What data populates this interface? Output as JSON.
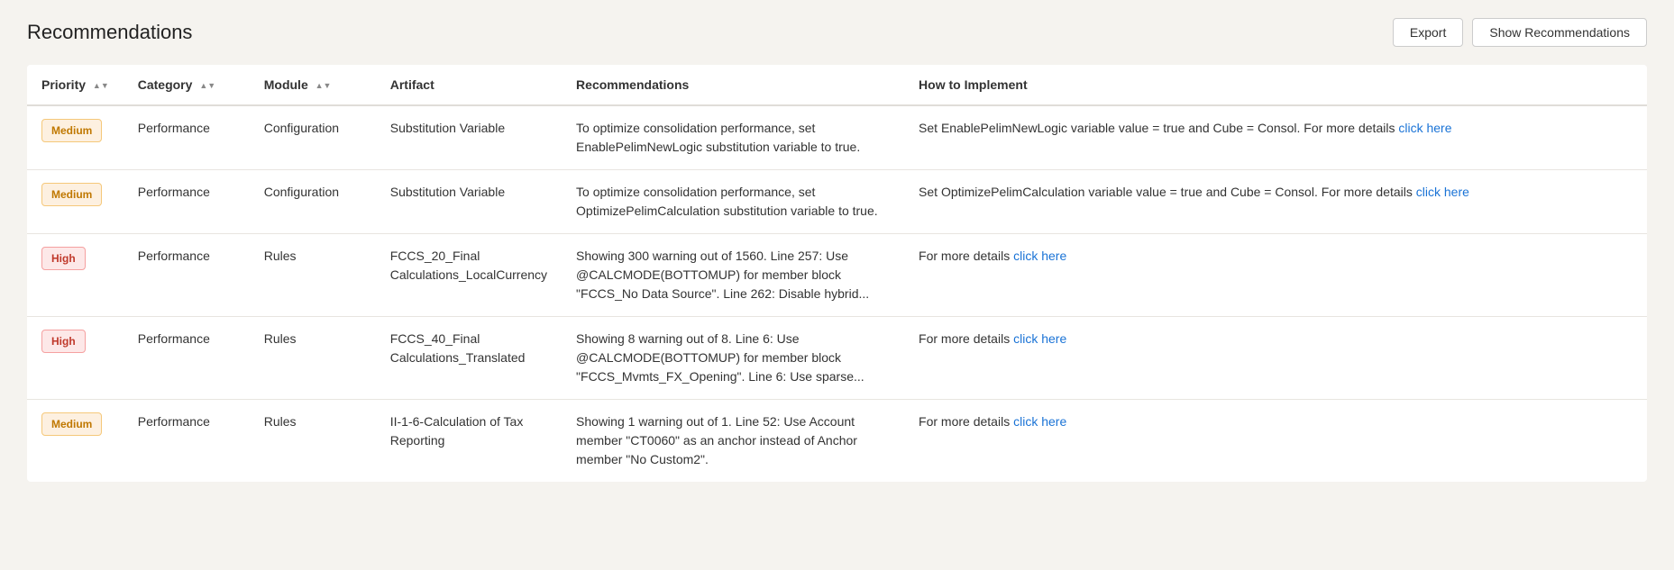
{
  "page": {
    "title": "Recommendations",
    "export_label": "Export",
    "show_recommendations_label": "Show Recommendations"
  },
  "table": {
    "columns": [
      {
        "key": "priority",
        "label": "Priority",
        "sortable": true
      },
      {
        "key": "category",
        "label": "Category",
        "sortable": true
      },
      {
        "key": "module",
        "label": "Module",
        "sortable": true
      },
      {
        "key": "artifact",
        "label": "Artifact",
        "sortable": false
      },
      {
        "key": "recommendations",
        "label": "Recommendations",
        "sortable": false
      },
      {
        "key": "implement",
        "label": "How to Implement",
        "sortable": false
      }
    ],
    "rows": [
      {
        "priority": "Medium",
        "priority_type": "medium",
        "category": "Performance",
        "module": "Configuration",
        "artifact": "Substitution Variable",
        "recommendations": "To optimize consolidation performance, set EnablePelimNewLogic substitution variable to true.",
        "implement_text": "Set EnablePelimNewLogic variable value = true and Cube = Consol. For more details ",
        "implement_link": "click here"
      },
      {
        "priority": "Medium",
        "priority_type": "medium",
        "category": "Performance",
        "module": "Configuration",
        "artifact": "Substitution Variable",
        "recommendations": "To optimize consolidation performance, set OptimizePelimCalculation substitution variable to true.",
        "implement_text": "Set OptimizePelimCalculation variable value = true and Cube = Consol. For more details ",
        "implement_link": "click here"
      },
      {
        "priority": "High",
        "priority_type": "high",
        "category": "Performance",
        "module": "Rules",
        "artifact": "FCCS_20_Final Calculations_LocalCurrency",
        "recommendations": "Showing 300 warning out of 1560. Line 257: Use @CALCMODE(BOTTOMUP) for member block \"FCCS_No Data Source\". Line 262: Disable hybrid...",
        "implement_text": "For more details ",
        "implement_link": "click here"
      },
      {
        "priority": "High",
        "priority_type": "high",
        "category": "Performance",
        "module": "Rules",
        "artifact": "FCCS_40_Final Calculations_Translated",
        "recommendations": "Showing 8 warning out of 8. Line 6: Use @CALCMODE(BOTTOMUP) for member block \"FCCS_Mvmts_FX_Opening\". Line 6: Use sparse...",
        "implement_text": "For more details ",
        "implement_link": "click here"
      },
      {
        "priority": "Medium",
        "priority_type": "medium",
        "category": "Performance",
        "module": "Rules",
        "artifact": "II-1-6-Calculation of Tax Reporting",
        "recommendations": "Showing 1 warning out of 1. Line 52: Use Account member \"CT0060\" as an anchor instead of Anchor member \"No Custom2\".",
        "implement_text": "For more details ",
        "implement_link": "click here"
      }
    ]
  }
}
